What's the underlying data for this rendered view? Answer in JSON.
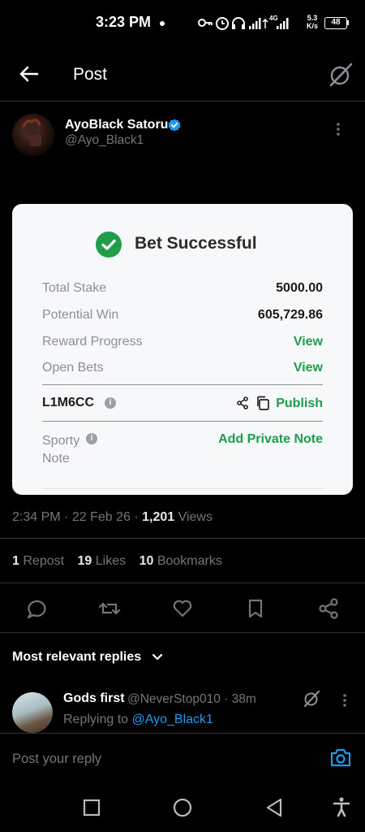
{
  "status_bar": {
    "time": "3:23 PM",
    "network_speed_top": "5.3",
    "network_speed_bottom": "K/s",
    "network_type": "4G",
    "battery": "48"
  },
  "header": {
    "title": "Post",
    "back_icon": "arrow-left-icon",
    "grok_icon": "grok-icon"
  },
  "author": {
    "name": "AyoBlack Satoru",
    "handle": "@Ayo_Black1",
    "verified_color": "#1d9bf0"
  },
  "bet_card": {
    "title": "Bet Successful",
    "rows": [
      {
        "label": "Total Stake",
        "value": "5000.00"
      },
      {
        "label": "Potential Win",
        "value": "605,729.86"
      },
      {
        "label": "Reward Progress",
        "value": "View"
      },
      {
        "label": "Open Bets",
        "value": "View"
      }
    ],
    "booking_code": "L1M6CC",
    "publish_label": "Publish",
    "note_label_line1": "Sporty",
    "note_label_line2": "Note",
    "add_note_label": "Add Private Note",
    "accent_color": "#1e9d4b"
  },
  "meta": {
    "time": "2:34 PM",
    "date": "22 Feb 26",
    "views_count": "1,201",
    "views_label": "Views"
  },
  "stats": {
    "reposts_count": "1",
    "reposts_label": "Repost",
    "likes_count": "19",
    "likes_label": "Likes",
    "bookmarks_count": "10",
    "bookmarks_label": "Bookmarks"
  },
  "replies": {
    "heading": "Most relevant replies",
    "items": [
      {
        "name": "Gods first",
        "handle": "@NeverStop010",
        "age": "38m",
        "replying_prefix": "Replying to",
        "replying_to": "@Ayo_Black1"
      }
    ]
  },
  "composer": {
    "placeholder": "Post your reply"
  }
}
